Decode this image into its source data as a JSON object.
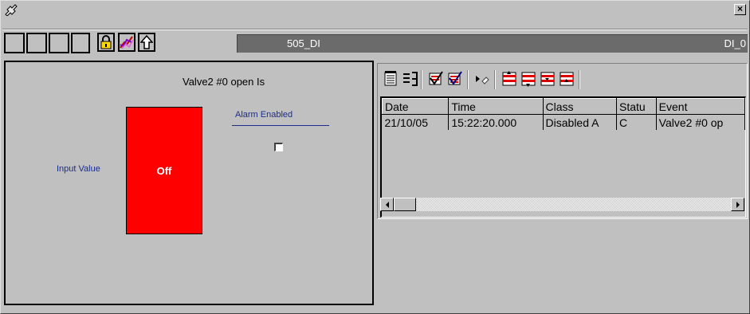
{
  "window": {
    "close_glyph": "×",
    "app_icon": "pin-icon"
  },
  "toolbar": {
    "empty_boxes": 4,
    "lock_icon": "lock-icon",
    "trend_icon": "trend-icon",
    "up_icon": "up-arrow-icon",
    "tag_name": "505_DI",
    "tag_description": "DI_0"
  },
  "left": {
    "title": "Valve2 #0 open Is",
    "input_label": "Input Value",
    "status_text": "Off",
    "status_color": "#ff0000",
    "alarm_label": "Alarm Enabled",
    "alarm_checked": false
  },
  "alarm_list": {
    "toolbar_icons": [
      "acknowledge-icon",
      "list-icon",
      "ack-selected-icon",
      "ack-all-icon",
      "play-icon",
      "priority-1-icon",
      "priority-2-icon",
      "priority-3-icon",
      "priority-4-icon"
    ],
    "columns": [
      "Date",
      "Time",
      "Class",
      "Statu",
      "Event"
    ],
    "rows": [
      [
        "21/10/05",
        "15:22:20.000",
        "Disabled A",
        "C",
        "Valve2 #0 op"
      ]
    ]
  }
}
